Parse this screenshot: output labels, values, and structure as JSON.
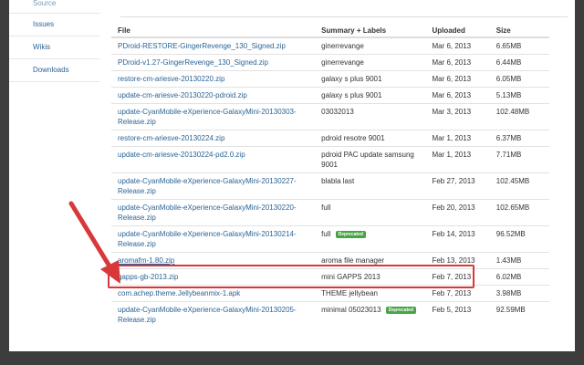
{
  "sidebar": {
    "items": [
      {
        "label": "Source"
      },
      {
        "label": "Issues"
      },
      {
        "label": "Wikis"
      },
      {
        "label": "Downloads"
      }
    ]
  },
  "table": {
    "headers": {
      "file": "File",
      "summary": "Summary + Labels",
      "uploaded": "Uploaded",
      "size": "Size"
    },
    "rows": [
      {
        "file": "PDroid-RESTORE-GingerRevenge_130_Signed.zip",
        "summary": "ginerrevange",
        "badge": "",
        "uploaded": "Mar 6, 2013",
        "size": "6.65MB"
      },
      {
        "file": "PDroid-v1.27-GingerRevenge_130_Signed.zip",
        "summary": "ginerrevange",
        "badge": "",
        "uploaded": "Mar 6, 2013",
        "size": "6.44MB"
      },
      {
        "file": "restore-cm-ariesve-20130220.zip",
        "summary": "galaxy s plus 9001",
        "badge": "",
        "uploaded": "Mar 6, 2013",
        "size": "6.05MB"
      },
      {
        "file": "update-cm-ariesve-20130220-pdroid.zip",
        "summary": "galaxy s plus 9001",
        "badge": "",
        "uploaded": "Mar 6, 2013",
        "size": "5.13MB"
      },
      {
        "file": "update-CyanMobile-eXperience-GalaxyMini-20130303-Release.zip",
        "summary": "03032013",
        "badge": "",
        "uploaded": "Mar 3, 2013",
        "size": "102.48MB"
      },
      {
        "file": "restore-cm-ariesve-20130224.zip",
        "summary": "pdroid resotre 9001",
        "badge": "",
        "uploaded": "Mar 1, 2013",
        "size": "6.37MB"
      },
      {
        "file": "update-cm-ariesve-20130224-pd2.0.zip",
        "summary": "pdroid PAC update samsung 9001",
        "badge": "",
        "uploaded": "Mar 1, 2013",
        "size": "7.71MB"
      },
      {
        "file": "update-CyanMobile-eXperience-GalaxyMini-20130227-Release.zip",
        "summary": "blabla last",
        "badge": "",
        "uploaded": "Feb 27, 2013",
        "size": "102.45MB"
      },
      {
        "file": "update-CyanMobile-eXperience-GalaxyMini-20130220-Release.zip",
        "summary": "full",
        "badge": "",
        "uploaded": "Feb 20, 2013",
        "size": "102.65MB"
      },
      {
        "file": "update-CyanMobile-eXperience-GalaxyMini-20130214-Release.zip",
        "summary": "full",
        "badge": "Deprecated",
        "uploaded": "Feb 14, 2013",
        "size": "96.52MB"
      },
      {
        "file": "aromafm-1.80.zip",
        "summary": "aroma file manager",
        "badge": "",
        "uploaded": "Feb 13, 2013",
        "size": "1.43MB"
      },
      {
        "file": "gapps-gb-2013.zip",
        "summary": "mini GAPPS 2013",
        "badge": "",
        "uploaded": "Feb 7, 2013",
        "size": "6.02MB"
      },
      {
        "file": "com.achep.theme.Jellybeanmix-1.apk",
        "summary": "THEME jellybean",
        "badge": "",
        "uploaded": "Feb 7, 2013",
        "size": "3.98MB"
      },
      {
        "file": "update-CyanMobile-eXperience-GalaxyMini-20130205-Release.zip",
        "summary": "minimal 05023013",
        "badge": "Deprecated",
        "uploaded": "Feb 5, 2013",
        "size": "92.59MB"
      }
    ]
  },
  "colors": {
    "link": "#2a6496",
    "highlight": "#d9383a",
    "badge": "#47a447"
  }
}
